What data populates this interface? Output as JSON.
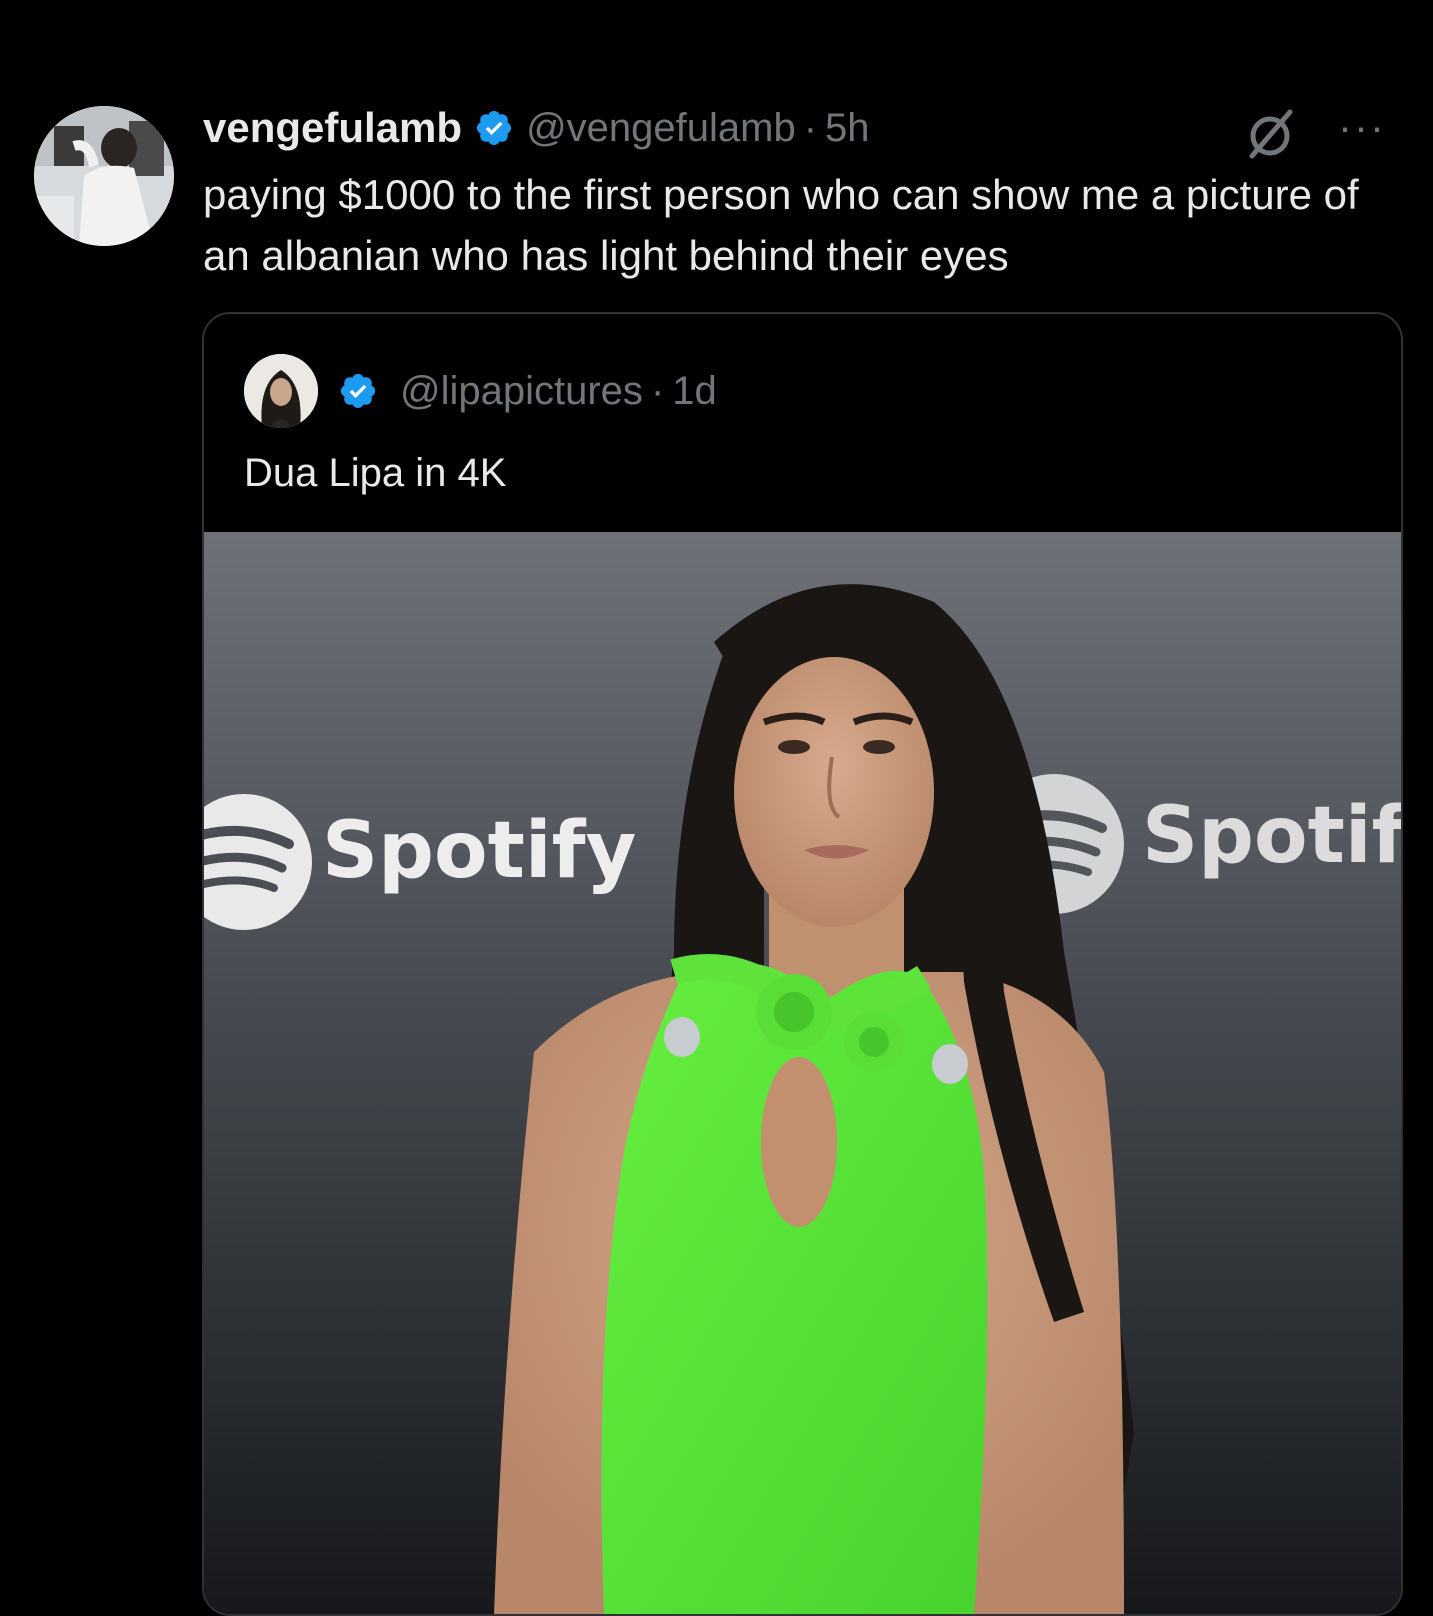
{
  "tweet": {
    "display_name": "vengefulamb",
    "handle": "@vengefulamb",
    "separator": "·",
    "time": "5h",
    "text": "paying $1000 to the first person who can show me a picture of an albanian who has light behind their eyes",
    "more_label": "···"
  },
  "quoted_tweet": {
    "handle": "@lipapictures",
    "separator": "·",
    "time": "1d",
    "text": "Dua Lipa in 4K",
    "photo_logos": [
      "Spotify",
      "Spotif"
    ]
  },
  "colors": {
    "background": "#000000",
    "text_primary": "#e7e9ea",
    "text_secondary": "#71767b",
    "verified_badge": "#1d9bf0",
    "border": "#2f3336",
    "dress_green": "#5de83a"
  },
  "icons": [
    "verified-badge-icon",
    "grok-icon",
    "more-options-icon"
  ]
}
